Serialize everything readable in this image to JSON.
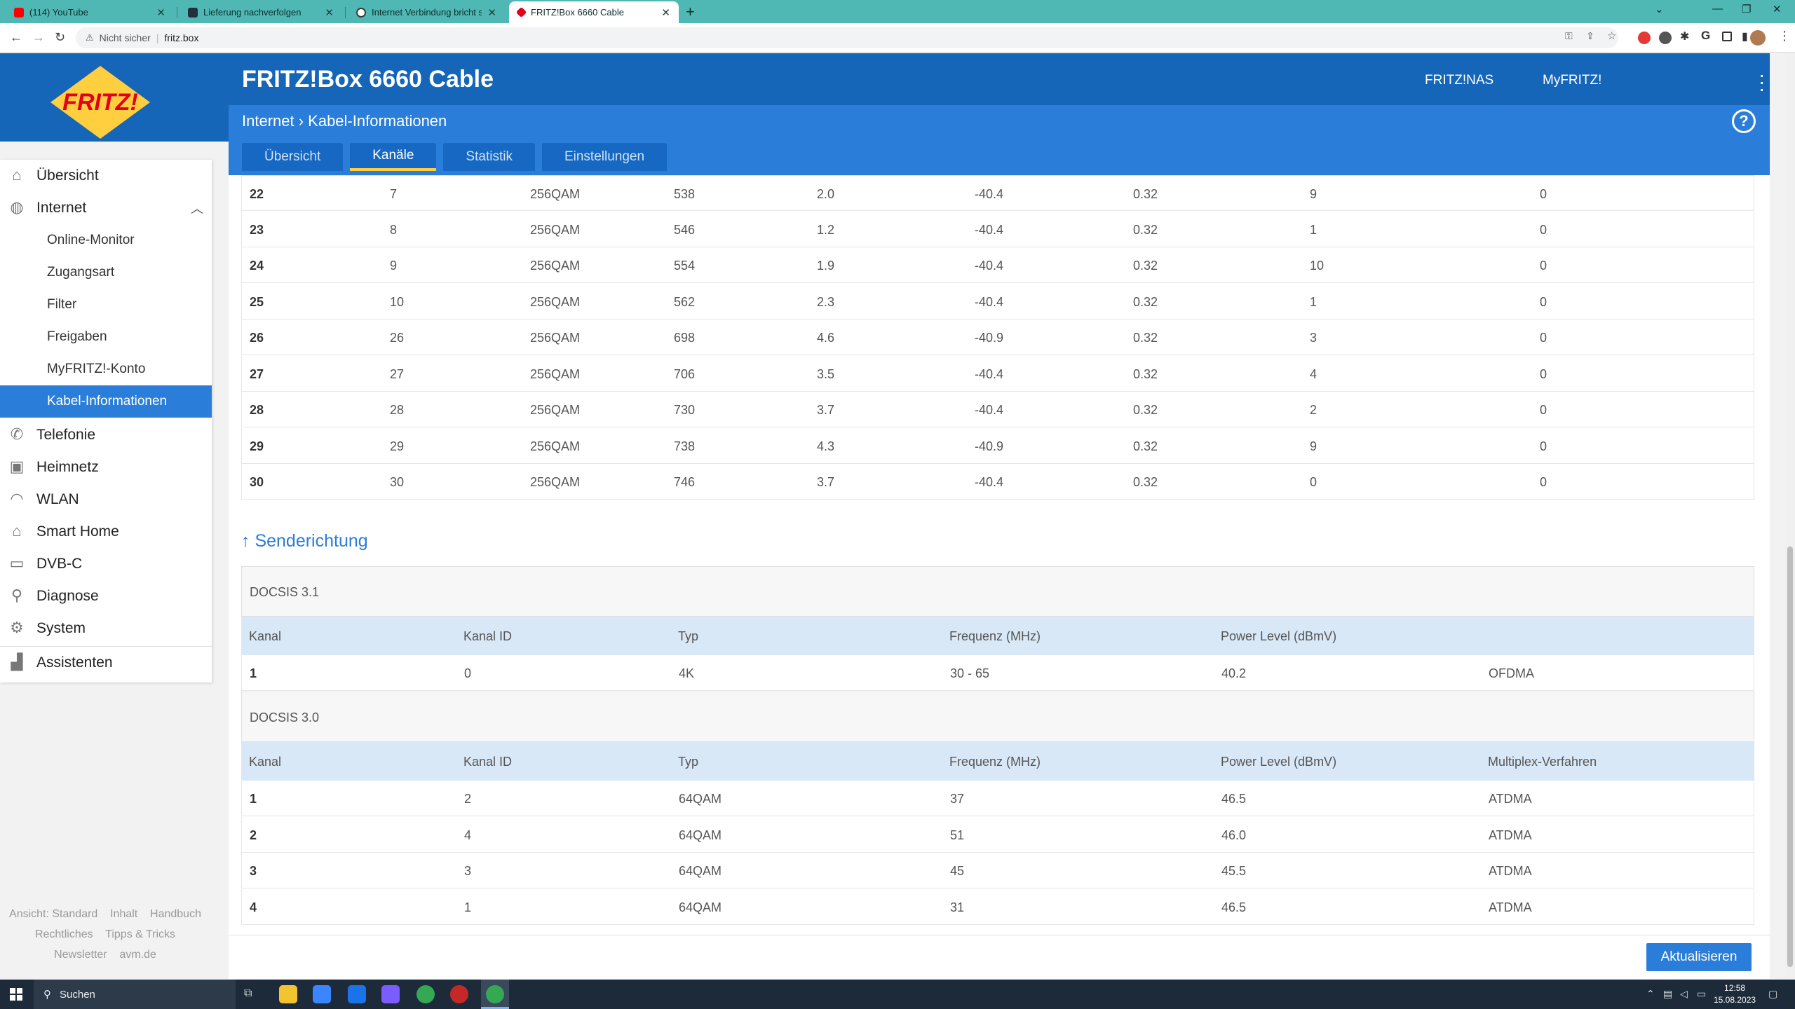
{
  "browser": {
    "tabs": [
      {
        "title": "(114) YouTube",
        "color": "#ff0000"
      },
      {
        "title": "Lieferung nachverfolgen",
        "color": "#232f3e"
      },
      {
        "title": "Internet Verbindung bricht ständig",
        "color": "#3a3a3a"
      },
      {
        "title": "FRITZ!Box 6660 Cable",
        "color": "#e2001a"
      }
    ],
    "address": {
      "security": "Nicht sicher",
      "url": "fritz.box"
    }
  },
  "header": {
    "logo_text": "FRITZ!",
    "title": "FRITZ!Box 6660 Cable",
    "links": [
      "FRITZ!NAS",
      "MyFRITZ!"
    ],
    "breadcrumb": "Internet › Kabel-Informationen",
    "tabs": [
      "Übersicht",
      "Kanäle",
      "Statistik",
      "Einstellungen"
    ],
    "active_tab": "Kanäle",
    "help_label": "?"
  },
  "sidebar": {
    "items": [
      {
        "label": "Übersicht",
        "icon": "home-icon"
      },
      {
        "label": "Internet",
        "icon": "globe-icon"
      },
      {
        "label": "Telefonie",
        "icon": "phone-icon"
      },
      {
        "label": "Heimnetz",
        "icon": "network-icon"
      },
      {
        "label": "WLAN",
        "icon": "wifi-icon"
      },
      {
        "label": "Smart Home",
        "icon": "smart-home-icon"
      },
      {
        "label": "DVB-C",
        "icon": "tv-icon"
      },
      {
        "label": "Diagnose",
        "icon": "diagnose-icon"
      },
      {
        "label": "System",
        "icon": "system-icon"
      },
      {
        "label": "Assistenten",
        "icon": "wizard-icon"
      }
    ],
    "sub_items": [
      "Online-Monitor",
      "Zugangsart",
      "Filter",
      "Freigaben",
      "MyFRITZ!-Konto",
      "Kabel-Informationen"
    ],
    "footer": [
      "Ansicht: Standard",
      "Inhalt",
      "Handbuch",
      "Rechtliches",
      "Tipps & Tricks",
      "Newsletter",
      "avm.de"
    ]
  },
  "downstream_rows": [
    [
      "22",
      "7",
      "256QAM",
      "538",
      "2.0",
      "-40.4",
      "0.32",
      "9",
      "0"
    ],
    [
      "23",
      "8",
      "256QAM",
      "546",
      "1.2",
      "-40.4",
      "0.32",
      "1",
      "0"
    ],
    [
      "24",
      "9",
      "256QAM",
      "554",
      "1.9",
      "-40.4",
      "0.32",
      "10",
      "0"
    ],
    [
      "25",
      "10",
      "256QAM",
      "562",
      "2.3",
      "-40.4",
      "0.32",
      "1",
      "0"
    ],
    [
      "26",
      "26",
      "256QAM",
      "698",
      "4.6",
      "-40.9",
      "0.32",
      "3",
      "0"
    ],
    [
      "27",
      "27",
      "256QAM",
      "706",
      "3.5",
      "-40.4",
      "0.32",
      "4",
      "0"
    ],
    [
      "28",
      "28",
      "256QAM",
      "730",
      "3.7",
      "-40.4",
      "0.32",
      "2",
      "0"
    ],
    [
      "29",
      "29",
      "256QAM",
      "738",
      "4.3",
      "-40.9",
      "0.32",
      "9",
      "0"
    ],
    [
      "30",
      "30",
      "256QAM",
      "746",
      "3.7",
      "-40.4",
      "0.32",
      "0",
      "0"
    ]
  ],
  "upstream": {
    "title": "↑ Senderichtung",
    "docsis31": {
      "label": "DOCSIS 3.1",
      "headers": [
        "Kanal",
        "Kanal ID",
        "Typ",
        "Frequenz (MHz)",
        "Power Level (dBmV)",
        ""
      ],
      "rows": [
        [
          "1",
          "0",
          "4K",
          "30 - 65",
          "40.2",
          "OFDMA"
        ]
      ]
    },
    "docsis30": {
      "label": "DOCSIS 3.0",
      "headers": [
        "Kanal",
        "Kanal ID",
        "Typ",
        "Frequenz (MHz)",
        "Power Level (dBmV)",
        "Multiplex-Verfahren"
      ],
      "rows": [
        [
          "1",
          "2",
          "64QAM",
          "37",
          "46.5",
          "ATDMA"
        ],
        [
          "2",
          "4",
          "64QAM",
          "51",
          "46.0",
          "ATDMA"
        ],
        [
          "3",
          "3",
          "64QAM",
          "45",
          "45.5",
          "ATDMA"
        ],
        [
          "4",
          "1",
          "64QAM",
          "31",
          "46.5",
          "ATDMA"
        ]
      ]
    }
  },
  "refresh_label": "Aktualisieren",
  "taskbar": {
    "search": "Suchen",
    "time": "12:58",
    "date": "15.08.2023"
  }
}
